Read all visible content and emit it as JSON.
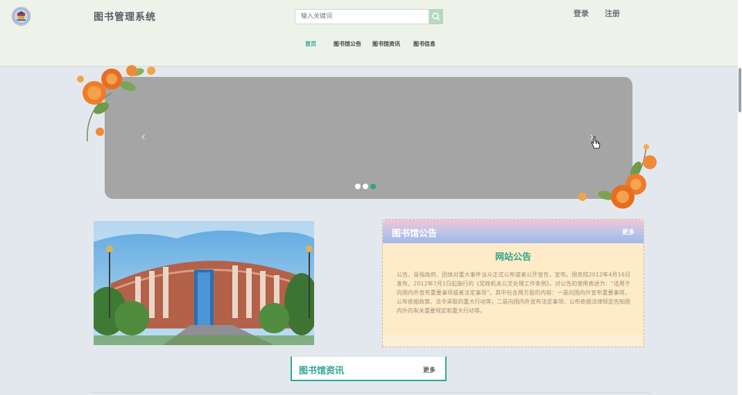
{
  "header": {
    "title": "图书管理系统",
    "search_placeholder": "输入关键词",
    "login": "登录",
    "register": "注册"
  },
  "nav": [
    {
      "label": "首页",
      "active": true
    },
    {
      "label": "图书馆公告",
      "active": false
    },
    {
      "label": "图书馆资讯",
      "active": false
    },
    {
      "label": "图书信息",
      "active": false
    }
  ],
  "banner": {
    "prev_arrow": "‹",
    "next_arrow": "›",
    "dots": 3,
    "active_dot": 3
  },
  "notice": {
    "title": "图书馆公告",
    "more": "更多",
    "subtitle": "网站公告",
    "body": "公告，是指政府、团体对重大事件当众正式公布或者公开宣告，宣布。国务院2012年4月16日发布、2012年7月1日起施行的《党政机关公文处理工作条例》，对公告的使用表述为：“适用于向国内外宣布重要事项或者法定事项”。其中包含两方面的内容：一是向国内外宣布重要事项，公布依据政策、法令采取的重大行动等；二是向国内外宣布法定事项，公布依据法律规定告知国内外的有关重要规定和重大行动等。"
  },
  "news": {
    "title": "图书馆资讯",
    "more": "更多"
  },
  "colors": {
    "accent": "#2ca58d",
    "header_bg": "#eef3ea",
    "page_bg": "#e3e8ee",
    "banner_bg": "#a5a5a5"
  },
  "icons": {
    "logo": "library-emblem-icon",
    "search": "search-icon",
    "cursor": "hand-pointer-icon",
    "flowers": "orange-flower-decoration-icon"
  }
}
